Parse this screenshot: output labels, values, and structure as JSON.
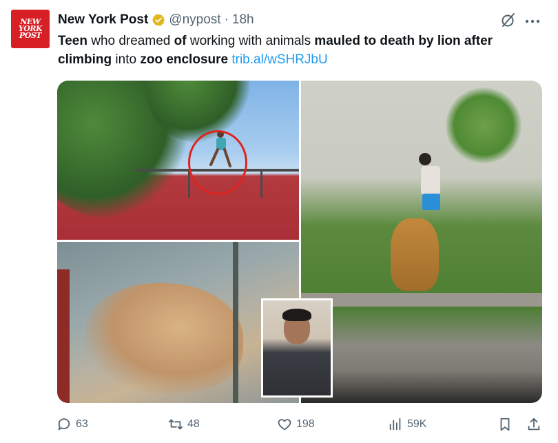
{
  "account": {
    "logo_text": "NEW\nYORK\nPOST",
    "display_name": "New York Post",
    "handle": "@nypost",
    "separator": "·",
    "time": "18h"
  },
  "tweet": {
    "text_parts": [
      {
        "text": "Teen",
        "bold": true
      },
      {
        "text": " who dreamed ",
        "bold": false
      },
      {
        "text": "of",
        "bold": true
      },
      {
        "text": " working with animals ",
        "bold": false
      },
      {
        "text": "mauled to death by lion after climbing",
        "bold": true
      },
      {
        "text": " into ",
        "bold": false
      },
      {
        "text": "zoo enclosure",
        "bold": true
      },
      {
        "text": " ",
        "bold": false
      }
    ],
    "link": "trib.al/wSHRJbU"
  },
  "icons": {
    "verified": "verified-badge-icon",
    "grok": "grok-icon",
    "more": "more-icon",
    "reply": "reply-icon",
    "retweet": "retweet-icon",
    "like": "heart-icon",
    "views": "views-icon",
    "bookmark": "bookmark-icon",
    "share": "share-icon"
  },
  "metrics": {
    "replies": "63",
    "retweets": "48",
    "likes": "198",
    "views": "59K"
  },
  "colors": {
    "brand_red": "#d71f26",
    "link_blue": "#1d9bf0",
    "verified_gold": "#e2b719",
    "muted": "#536471",
    "highlight_circle": "#e0231c"
  }
}
